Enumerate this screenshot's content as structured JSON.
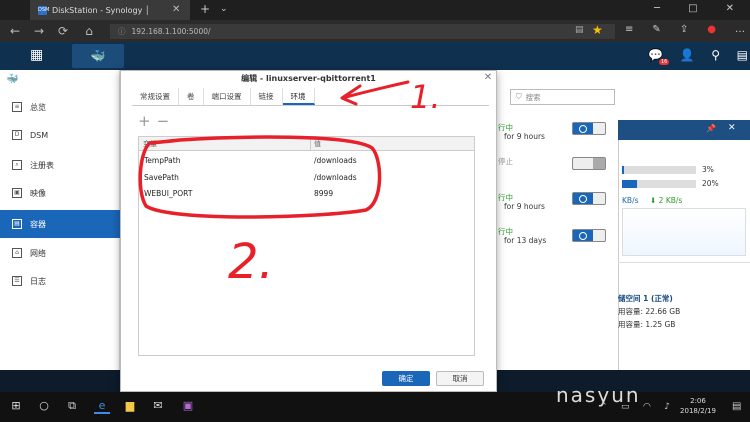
{
  "browser": {
    "tab_title": "DiskStation - Synology │",
    "tab_icon": "DSM",
    "url": "192.168.1.100:5000/",
    "nav": [
      "←",
      "→",
      "⟳",
      "⌂"
    ],
    "new_tab": "+"
  },
  "dsm": {
    "notif_count": "16"
  },
  "sidebar": {
    "items": [
      {
        "label": "总览",
        "icon": "overview-icon",
        "glyph": "≡"
      },
      {
        "label": "DSM",
        "icon": "dsm-icon",
        "glyph": "D"
      },
      {
        "label": "注册表",
        "icon": "registry-icon",
        "glyph": "⌕"
      },
      {
        "label": "映像",
        "icon": "image-icon",
        "glyph": "▣"
      },
      {
        "label": "容器",
        "icon": "container-icon",
        "glyph": "▤"
      },
      {
        "label": "网络",
        "icon": "network-icon",
        "glyph": "⌂"
      },
      {
        "label": "日志",
        "icon": "log-icon",
        "glyph": "☰"
      }
    ]
  },
  "search": {
    "placeholder": "搜索"
  },
  "containers": [
    {
      "status": "行中",
      "uptime": "for 9 hours",
      "on": true
    },
    {
      "status": "停止",
      "uptime": "",
      "on": false
    },
    {
      "status": "行中",
      "uptime": "for 9 hours",
      "on": true
    },
    {
      "status": "行中",
      "uptime": "for 13 days",
      "on": true
    }
  ],
  "right_panel": {
    "cpu": "3%",
    "ram": "20%",
    "cpu_fraction": 0.03,
    "ram_fraction": 0.2,
    "net_up": "KB/s",
    "net_down": "⬇ 2 KB/s",
    "volume_title": "储空间 1 (正常)",
    "used": "用容量: 22.66 GB",
    "free": "用容量: 1.25 GB"
  },
  "dialog": {
    "title": "编辑 - linuxserver-qbittorrent1",
    "tabs": [
      "常规设置",
      "卷",
      "端口设置",
      "链接",
      "环境"
    ],
    "plus": "+",
    "minus": "−",
    "col_name": "变量",
    "col_value": "值",
    "env": [
      {
        "name": "TempPath",
        "value": "/downloads"
      },
      {
        "name": "SavePath",
        "value": "/downloads"
      },
      {
        "name": "WEBUI_PORT",
        "value": "8999"
      }
    ],
    "ok": "确定",
    "cancel": "取消"
  },
  "annotations": {
    "one": "1.",
    "two": "2.",
    "color": "#e8202a"
  },
  "taskbar": {
    "time": "2:06",
    "date": "2018/2/19",
    "watermark": "nasyun"
  }
}
